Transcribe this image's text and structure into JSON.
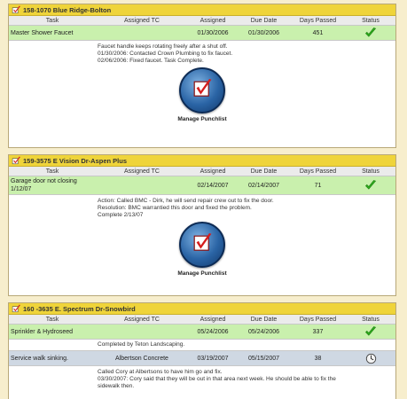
{
  "columns": {
    "task": "Task",
    "assigned_tc": "Assigned TC",
    "assigned": "Assigned",
    "due_date": "Due Date",
    "days_passed": "Days Passed",
    "status": "Status"
  },
  "manage_label": "Manage Punchlist",
  "colors": {
    "header": "#efd43a",
    "complete_row": "#c9f0ad",
    "pending_row": "#cfd8e3",
    "check": "#2fae1d"
  },
  "panels": [
    {
      "title": "158-1070 Blue Ridge-Bolton",
      "items": [
        {
          "task": "Master Shower Faucet",
          "tc": "",
          "assigned": "01/30/2006",
          "due": "01/30/2006",
          "days": "451",
          "status": "check-icon",
          "notes": [
            "Faucet handle keeps rotating freely after a shut off.",
            "01/30/2006: Contacted Crown Plumbing to fix faucet.",
            "02/06/2006: Fixed faucet. Task Complete."
          ]
        }
      ]
    },
    {
      "title": "159-3575 E Vision Dr-Aspen Plus",
      "items": [
        {
          "task_line1": "Garage door not closing",
          "task_line2": "1/12/07",
          "tc": "",
          "assigned": "02/14/2007",
          "due": "02/14/2007",
          "days": "71",
          "status": "check-icon",
          "notes": [
            "Action: Called BMC - Dirk, he will send repair crew out to fix the door.",
            "Resolution: BMC warrantied this door and fixed the problem.",
            "Complete 2/13/07"
          ]
        }
      ]
    },
    {
      "title": "160 -3635 E. Spectrum Dr-Snowbird",
      "items": [
        {
          "task": "Sprinkler & Hydroseed",
          "tc": "",
          "assigned": "05/24/2006",
          "due": "05/24/2006",
          "days": "337",
          "status": "check-icon",
          "notes": [
            "Completed by Teton Landscaping."
          ]
        },
        {
          "task": "Service walk sinking.",
          "tc": "Albertson Concrete",
          "assigned": "03/19/2007",
          "due": "05/15/2007",
          "days": "38",
          "status": "clock-icon",
          "notes": [
            "Called Cory at Albertsons to have him go and fix.",
            "03/30/2007: Cory said that they will be out in that area next week. He should be able to fix the",
            "sidewalk then."
          ]
        }
      ]
    }
  ]
}
